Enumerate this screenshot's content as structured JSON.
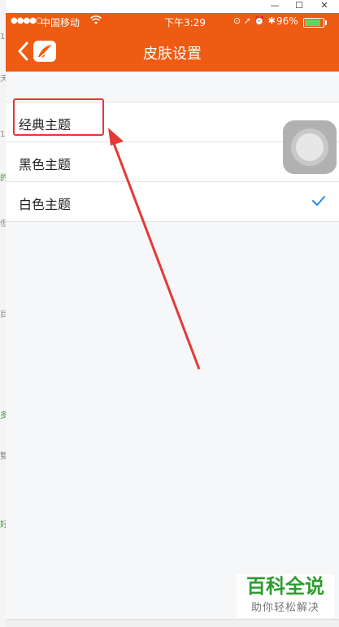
{
  "status_bar": {
    "signal": "●●●●○",
    "carrier": "中国移动",
    "wifi": "",
    "time": "下午3:29",
    "status_icons": "⊙ ➚ ⏰ ✱",
    "battery": "96%",
    "battery_level": 0.96,
    "battery_fill_color": "#5cd65c"
  },
  "nav": {
    "title": "皮肤设置",
    "bar_color": "#ee5b12"
  },
  "themes": [
    {
      "label": "经典主题",
      "selected": false
    },
    {
      "label": "黑色主题",
      "selected": false
    },
    {
      "label": "白色主题",
      "selected": true
    }
  ],
  "check_color": "#1e88e5",
  "annotation_color": "#e53935",
  "watermark": {
    "main": "百科全说",
    "sub": "助你轻松解决"
  },
  "window_controls": [
    "—",
    "☐",
    "✕"
  ],
  "background_fragments": [
    "天",
    "1",
    "的",
    "1",
    "但",
    "目",
    "多",
    "雙",
    "好"
  ]
}
